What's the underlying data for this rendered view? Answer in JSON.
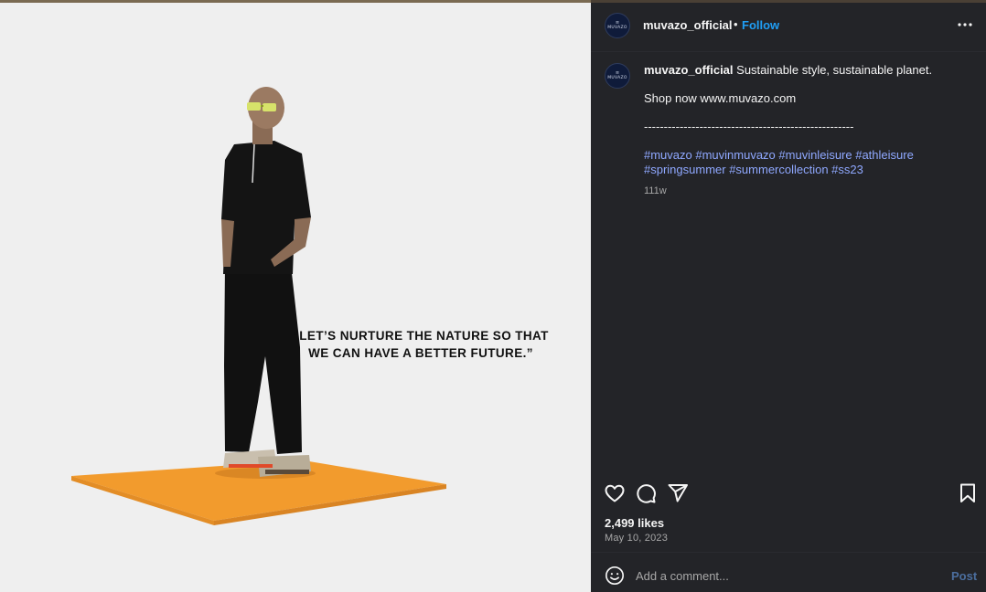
{
  "post_image": {
    "quote": "“LET’S NURTURE THE NATURE SO THAT WE CAN HAVE A BETTER FUTURE.”",
    "background": "#efefef",
    "platform_color": "#f29b2d"
  },
  "header": {
    "username": "muvazo_official",
    "separator": "•",
    "follow_label": "Follow",
    "more_icon": "more-horizontal-icon",
    "avatar_mark": "≡",
    "avatar_word": "MUVAZO"
  },
  "caption": {
    "username": "muvazo_official",
    "text": "Sustainable style, sustainable planet.",
    "shop_line": "Shop now www.muvazo.com",
    "dashes": "-----------------------------------------------------",
    "hashtags_line1": "#muvazo #muvinmuvazo #muvinleisure #athleisure",
    "hashtags_line2": "#springsummer #summercollection #ss23",
    "age": "111w"
  },
  "actions": {
    "like_icon": "heart-icon",
    "comment_icon": "comment-icon",
    "share_icon": "send-icon",
    "save_icon": "bookmark-icon"
  },
  "likes": "2,499 likes",
  "date": "May 10, 2023",
  "comment_box": {
    "placeholder": "Add a comment...",
    "post_label": "Post",
    "emoji_icon": "smiley-icon"
  },
  "colors": {
    "panel_bg": "#232428",
    "link_blue": "#1f9ef5",
    "hashtag": "#8fa8ff",
    "post_disabled": "#4b6e9e"
  }
}
